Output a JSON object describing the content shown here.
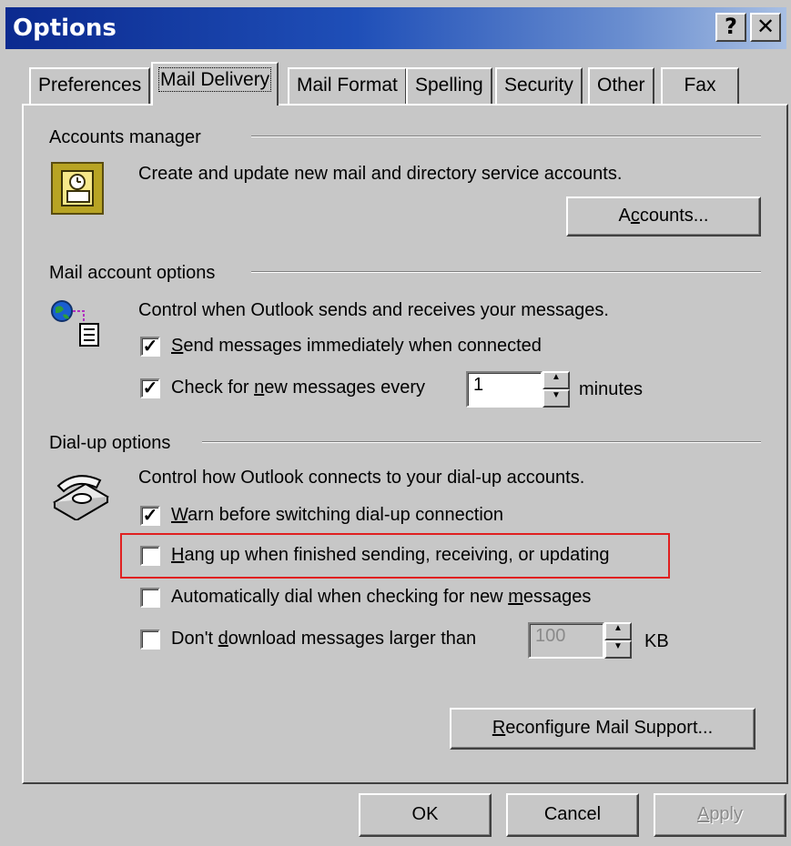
{
  "window": {
    "title": "Options"
  },
  "titlebar_buttons": {
    "help": "?",
    "close": "✕"
  },
  "tabs": [
    {
      "label": "Preferences"
    },
    {
      "label": "Mail Delivery"
    },
    {
      "label": "Mail Format"
    },
    {
      "label": "Spelling"
    },
    {
      "label": "Security"
    },
    {
      "label": "Other"
    },
    {
      "label": "Fax"
    }
  ],
  "accounts": {
    "section": "Accounts manager",
    "description": "Create and update new mail and directory service accounts.",
    "button": {
      "pre": "A",
      "key": "c",
      "post": "counts..."
    }
  },
  "mail_options": {
    "section": "Mail account options",
    "description": "Control when Outlook sends and receives your messages.",
    "send_immediately": {
      "checked": true,
      "key": "S",
      "rest": "end messages immediately when connected"
    },
    "check_new": {
      "checked": true,
      "pre": "Check for ",
      "key": "n",
      "rest": "ew messages every",
      "value": "1",
      "unit": "minutes"
    }
  },
  "dialup": {
    "section": "Dial-up options",
    "description": "Control how Outlook connects to your dial-up accounts.",
    "warn": {
      "checked": true,
      "key": "W",
      "rest": "arn before switching dial-up connection"
    },
    "hangup": {
      "checked": false,
      "key": "H",
      "rest": "ang up when finished sending, receiving, or updating"
    },
    "autodial": {
      "checked": false,
      "pre": "Automatically dial when checking for new ",
      "key": "m",
      "rest": "essages"
    },
    "no_download": {
      "checked": false,
      "pre": "Don't ",
      "key": "d",
      "rest": "ownload messages larger than",
      "value": "100",
      "unit": "KB"
    }
  },
  "reconfigure": {
    "key": "R",
    "rest": "econfigure Mail Support..."
  },
  "footer": {
    "ok": "OK",
    "cancel": "Cancel",
    "apply_key": "A",
    "apply_rest": "pply"
  }
}
